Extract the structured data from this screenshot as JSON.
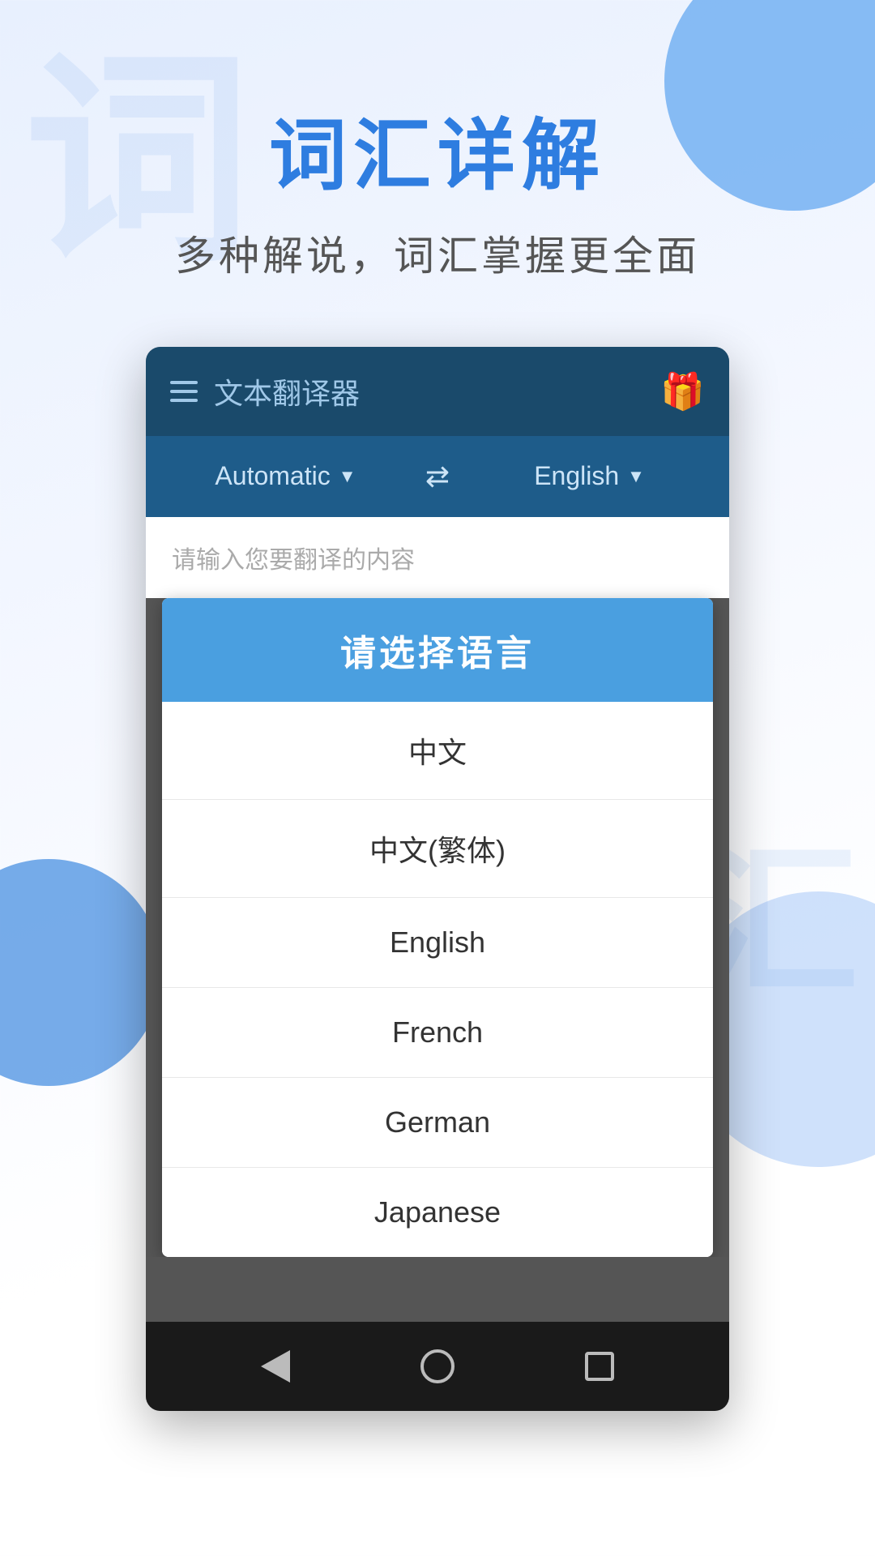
{
  "page": {
    "title": "词汇详解",
    "subtitle": "多种解说，词汇掌握更全面",
    "bg_char_top": "词",
    "bg_char_bottom": "汇"
  },
  "app": {
    "topbar": {
      "title": "文本翻译器",
      "gift_icon": "🎁"
    },
    "lang_selector": {
      "source_lang": "Automatic",
      "target_lang": "English",
      "swap_icon": "⇄"
    },
    "input_placeholder": "请输入您要翻译的内容"
  },
  "modal": {
    "title": "请选择语言",
    "items": [
      {
        "label": "中文"
      },
      {
        "label": "中文(繁体)"
      },
      {
        "label": "English"
      },
      {
        "label": "French"
      },
      {
        "label": "German"
      },
      {
        "label": "Japanese"
      }
    ]
  },
  "navbar": {
    "back_label": "◀",
    "home_label": "⬤",
    "recents_label": "▪"
  }
}
